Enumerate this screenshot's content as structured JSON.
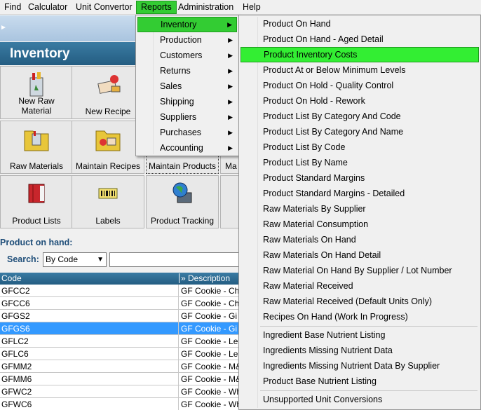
{
  "menubar": {
    "items": [
      "Find",
      "Calculator",
      "Unit Convertor",
      "Reports",
      "Administration",
      "Help"
    ]
  },
  "app": {
    "section_title": "Inventory",
    "tiles": [
      {
        "label_line1": "New Raw",
        "label_line2": "Material",
        "icon": "bag-icon"
      },
      {
        "label_line1": "New Recipe",
        "label_line2": "",
        "icon": "recipe-icon"
      },
      {
        "label_line1": "Raw Materials",
        "label_line2": "",
        "icon": "folder-bag-icon"
      },
      {
        "label_line1": "Maintain Recipes",
        "label_line2": "",
        "icon": "folder-recipe-icon"
      },
      {
        "label_line1": "Maintain Products",
        "label_line2": "",
        "icon": "folder-icon"
      },
      {
        "label_line1": "Ma",
        "label_line2": "",
        "icon": ""
      },
      {
        "label_line1": "Product Lists",
        "label_line2": "",
        "icon": "book-icon"
      },
      {
        "label_line1": "Labels",
        "label_line2": "",
        "icon": "barcode-icon"
      },
      {
        "label_line1": "Product Tracking",
        "label_line2": "",
        "icon": "globe-computer-icon"
      }
    ],
    "onhand_label": "Product on hand:",
    "search_label": "Search:",
    "search_mode": "By Code",
    "grid": {
      "columns": [
        "Code",
        "» Description"
      ],
      "rows": [
        {
          "code": "GFCC2",
          "desc": "GF Cookie - Ch"
        },
        {
          "code": "GFCC6",
          "desc": "GF Cookie - Ch"
        },
        {
          "code": "GFGS2",
          "desc": "GF Cookie - Gi"
        },
        {
          "code": "GFGS6",
          "desc": "GF Cookie - Gi"
        },
        {
          "code": "GFLC2",
          "desc": "GF Cookie - Le"
        },
        {
          "code": "GFLC6",
          "desc": "GF Cookie - Le"
        },
        {
          "code": "GFMM2",
          "desc": "GF Cookie - M&"
        },
        {
          "code": "GFMM6",
          "desc": "GF Cookie - M&"
        },
        {
          "code": "GFWC2",
          "desc": "GF Cookie - Wh"
        },
        {
          "code": "GFWC6",
          "desc": "GF Cookie - Wh"
        }
      ],
      "selected_row": 3
    }
  },
  "reports_menu": {
    "items": [
      "Inventory",
      "Production",
      "Customers",
      "Returns",
      "Sales",
      "Shipping",
      "Suppliers",
      "Purchases",
      "Accounting"
    ],
    "highlighted": "Inventory"
  },
  "inventory_submenu": {
    "group1": [
      "Product On Hand",
      "Product On Hand - Aged Detail",
      "Product Inventory Costs",
      "Product At or Below Minimum Levels",
      "Product On Hold - Quality Control",
      "Product On Hold - Rework",
      "Product List By Category And Code",
      "Product List By Category And Name",
      "Product List By Code",
      "Product List By Name",
      "Product Standard Margins",
      "Product Standard Margins - Detailed",
      "Raw Materials By Supplier",
      "Raw Material Consumption",
      "Raw Materials On Hand",
      "Raw Materials On Hand Detail",
      "Raw Material On Hand By Supplier / Lot Number",
      "Raw Material Received",
      "Raw Material Received (Default Units Only)",
      "Recipes On Hand (Work In Progress)"
    ],
    "group2": [
      "Ingredient Base Nutrient Listing",
      "Ingredients Missing Nutrient Data",
      "Ingredients Missing Nutrient Data By Supplier",
      "Product Base Nutrient Listing"
    ],
    "group3": [
      "Unsupported Unit Conversions"
    ],
    "highlighted": "Product Inventory Costs"
  },
  "colors": {
    "highlight": "#33ee33",
    "header_blue": "#245d82",
    "selection_blue": "#3399ff"
  }
}
